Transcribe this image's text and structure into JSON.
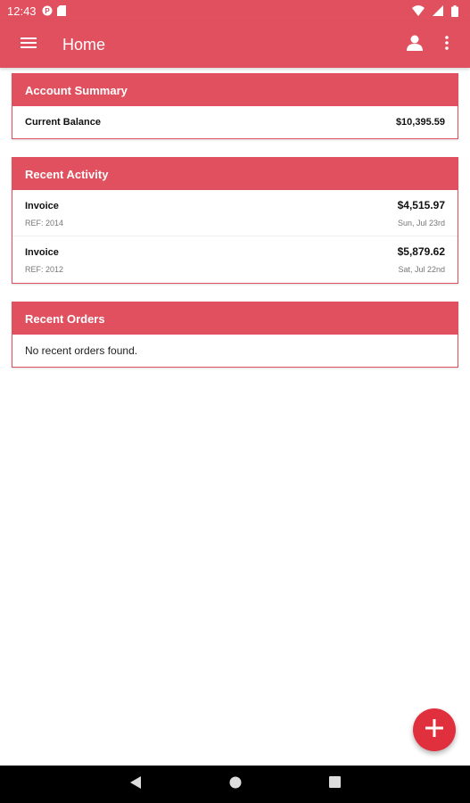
{
  "status_bar": {
    "time": "12:43"
  },
  "app_bar": {
    "title": "Home"
  },
  "account_summary": {
    "header": "Account Summary",
    "balance_label": "Current Balance",
    "balance_value": "$10,395.59"
  },
  "recent_activity": {
    "header": "Recent Activity",
    "items": [
      {
        "title": "Invoice",
        "ref": "REF: 2014",
        "amount": "$4,515.97",
        "date": "Sun, Jul 23rd"
      },
      {
        "title": "Invoice",
        "ref": "REF: 2012",
        "amount": "$5,879.62",
        "date": "Sat, Jul 22nd"
      }
    ]
  },
  "recent_orders": {
    "header": "Recent Orders",
    "empty_text": "No recent orders found."
  },
  "colors": {
    "primary": "#e0505e",
    "fab": "#e0303e"
  },
  "icons": {
    "menu": "hamburger-menu-icon",
    "profile": "person-icon",
    "overflow": "more-vertical-icon",
    "fab": "plus-icon",
    "nav_back": "triangle-back-icon",
    "nav_home": "circle-home-icon",
    "nav_recents": "square-recents-icon"
  }
}
